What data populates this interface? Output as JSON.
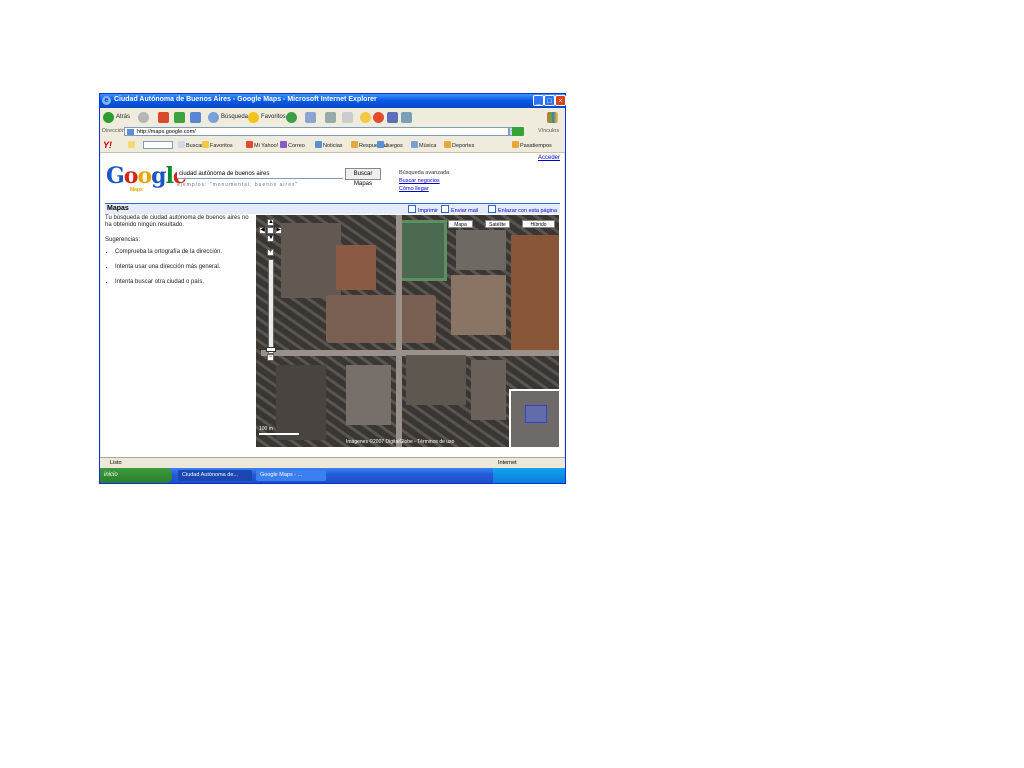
{
  "window": {
    "title": "Ciudad Autónoma de Buenos Aires - Google Maps - Microsoft Internet Explorer",
    "minimize": "_",
    "maximize": "□",
    "close": "×"
  },
  "toolbar": {
    "back": "Atrás",
    "search": "Búsqueda",
    "favorites": "Favoritos"
  },
  "address": {
    "label": "Dirección",
    "url": "http://maps.google.com/",
    "links_label": "Vínculos"
  },
  "yahoo_bar": {
    "logo": "Y!",
    "buttons": [
      "Buscar",
      "Favoritos",
      "Mi Yahoo!",
      "Correo",
      "Noticias",
      "Respuestas",
      "Juegos",
      "Música",
      "Deportes",
      "Pasatiempos"
    ]
  },
  "page": {
    "signin": "Acceder",
    "logo_sub": "Maps",
    "search_value": "ciudad autónoma de buenos aires",
    "search_button": "Buscar Mapas",
    "search_hint": "ejemplos: \"monumental, buenos aires\"",
    "side_links": [
      "Búsqueda avanzada",
      "Buscar negocios",
      "Cómo llegar"
    ],
    "maps_tab": "Mapas",
    "map_links": [
      "Imprimir",
      "Enviar mail",
      "Enlazar con esta página"
    ]
  },
  "results": {
    "message": "Tu búsqueda de ciudad autónoma de buenos aires no ha obtenido ningún resultado.",
    "suggestions_title": "Sugerencias:",
    "suggestions": [
      "Comprueba la ortografía de la dirección.",
      "Intenta usar una dirección más general.",
      "Intenta buscar otra ciudad o país."
    ]
  },
  "map": {
    "types": [
      "Mapa",
      "Satélite",
      "Híbrido"
    ],
    "zoom_in": "+",
    "zoom_out": "−",
    "pan_up": "▲",
    "pan_left": "◀",
    "pan_right": "▶",
    "pan_down": "▼",
    "scale_text": "100 m",
    "copyright": "Imágenes ©2007 DigitalGlobe - Términos de uso"
  },
  "statusbar": {
    "status": "Listo",
    "zone": "Internet"
  },
  "taskbar": {
    "start": "inicio",
    "tasks": [
      "Ciudad Autónoma de...",
      "Google Maps - ..."
    ]
  }
}
